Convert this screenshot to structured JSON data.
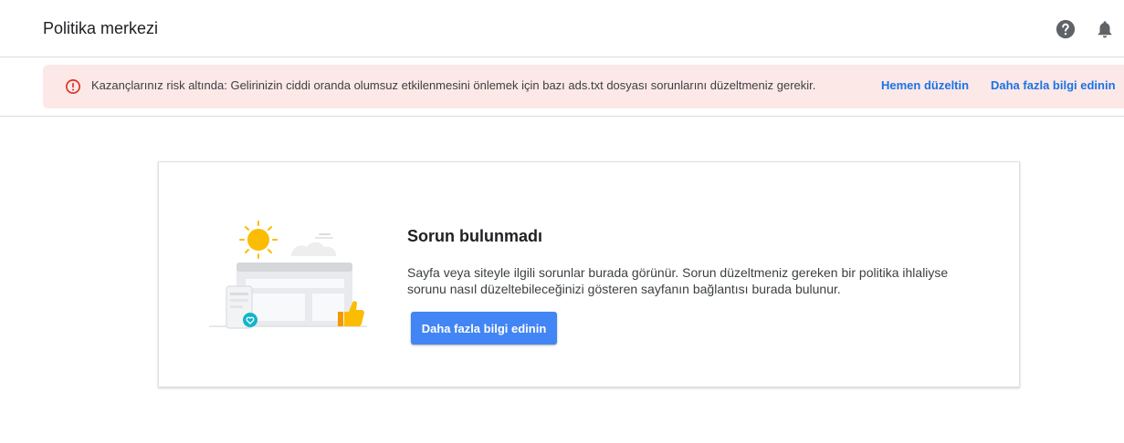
{
  "header": {
    "title": "Politika merkezi",
    "help_icon": "help-circle-icon",
    "notifications_icon": "bell-icon"
  },
  "banner": {
    "icon": "error-outline-icon",
    "message": "Kazançlarınız risk altında: Gelirinizin ciddi oranda olumsuz etkilenmesini önlemek için bazı ads.txt dosyası sorunlarını düzeltmeniz gerekir.",
    "fix_link": "Hemen düzeltin",
    "learn_link": "Daha fazla bilgi edinin",
    "colors": {
      "background": "#fce8e6",
      "icon": "#d93025",
      "link": "#1a73e8"
    }
  },
  "card": {
    "title": "Sorun bulunmadı",
    "description": "Sayfa veya siteyle ilgili sorunlar burada görünür. Sorun düzeltmeniz gereken bir politika ihlaliyse sorunu nasıl düzeltebileceğinizi gösteren sayfanın bağlantısı burada bulunur.",
    "button_label": "Daha fazla bilgi edinin",
    "illustration_icons": [
      "sun-icon",
      "browser-window-icon",
      "mobile-phone-icon",
      "heart-badge-icon",
      "thumbs-up-icon"
    ],
    "colors": {
      "button": "#4285f4"
    }
  }
}
